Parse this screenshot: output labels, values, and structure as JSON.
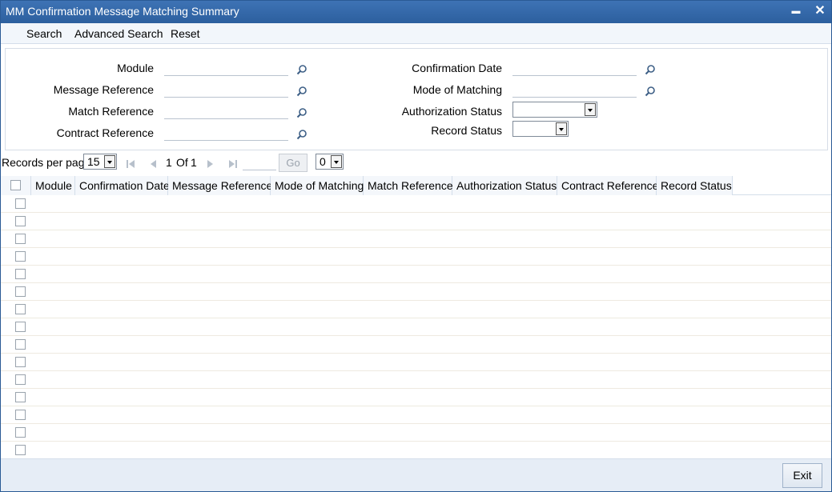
{
  "window": {
    "title": "MM Confirmation Message Matching Summary",
    "minimize_glyph": "▬",
    "close_glyph": "✕"
  },
  "menu": {
    "search": "Search",
    "advanced_search": "Advanced Search",
    "reset": "Reset"
  },
  "fields": {
    "module": {
      "label": "Module",
      "value": ""
    },
    "message_reference": {
      "label": "Message Reference",
      "value": ""
    },
    "match_reference": {
      "label": "Match Reference",
      "value": ""
    },
    "contract_reference": {
      "label": "Contract Reference",
      "value": ""
    },
    "confirmation_date": {
      "label": "Confirmation Date",
      "value": ""
    },
    "mode_of_matching": {
      "label": "Mode of Matching",
      "value": ""
    },
    "authorization_status": {
      "label": "Authorization Status",
      "value": ""
    },
    "record_status": {
      "label": "Record Status",
      "value": ""
    }
  },
  "pager": {
    "records_per_page_label": "Records per page",
    "records_per_page": "15",
    "current_page": "1",
    "of_label": "Of",
    "total_pages": "1",
    "go_label": "Go",
    "page_select": "0"
  },
  "grid": {
    "columns": [
      "Module",
      "Confirmation Date",
      "Message Reference",
      "Mode of Matching",
      "Match Reference",
      "Authorization Status",
      "Contract Reference",
      "Record Status"
    ],
    "row_count": 15
  },
  "footer": {
    "exit_label": "Exit"
  },
  "icons": {
    "lookup": "search-lookup-icon",
    "first": "first-page-icon",
    "prev": "previous-page-icon",
    "next": "next-page-icon",
    "last": "last-page-icon"
  },
  "colors": {
    "titlebar": "#2c5f9e",
    "footer": "#e6edf6",
    "row_line": "#eeeae0"
  }
}
